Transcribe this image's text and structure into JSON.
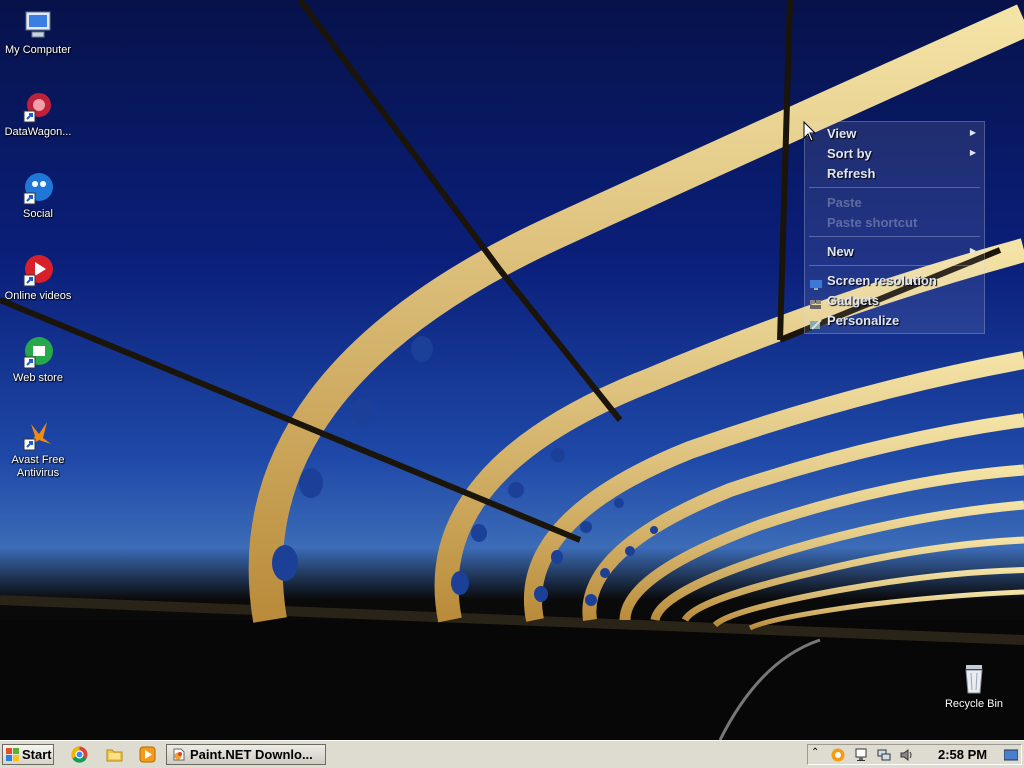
{
  "desktop": {
    "icons": [
      {
        "label": "My Computer",
        "icon": "computer-icon"
      },
      {
        "label": "DataWagon...",
        "icon": "datawagon-icon"
      },
      {
        "label": "Social",
        "icon": "social-icon"
      },
      {
        "label": "Online videos",
        "icon": "video-icon"
      },
      {
        "label": "Web store",
        "icon": "store-icon"
      },
      {
        "label": "Avast Free Antivirus",
        "icon": "avast-icon"
      },
      {
        "label": "Recycle Bin",
        "icon": "recycle-bin-icon"
      }
    ]
  },
  "context_menu": {
    "items": [
      {
        "label": "View",
        "enabled": true,
        "submenu": true
      },
      {
        "label": "Sort by",
        "enabled": true,
        "submenu": true
      },
      {
        "label": "Refresh",
        "enabled": true,
        "submenu": false
      },
      {
        "label": "Paste",
        "enabled": false,
        "submenu": false
      },
      {
        "label": "Paste shortcut",
        "enabled": false,
        "submenu": false
      },
      {
        "label": "New",
        "enabled": true,
        "submenu": true
      },
      {
        "label": "Screen resolution",
        "enabled": true,
        "submenu": false,
        "icon": "screen-resolution-icon"
      },
      {
        "label": "Gadgets",
        "enabled": true,
        "submenu": false,
        "icon": "gadgets-icon"
      },
      {
        "label": "Personalize",
        "enabled": true,
        "submenu": false,
        "icon": "personalize-icon"
      }
    ]
  },
  "taskbar": {
    "start_label": "Start",
    "quick_launch": [
      "chrome-icon",
      "explorer-icon",
      "media-player-icon"
    ],
    "tasks": [
      {
        "label": "Paint.NET Downlo...",
        "icon": "paint-net-icon"
      }
    ],
    "tray": {
      "icons": [
        "show-hidden-icons-chevron",
        "avast-tray-icon",
        "action-center-icon",
        "network-icon",
        "volume-icon"
      ],
      "clock": "2:58 PM"
    }
  },
  "colors": {
    "taskbar": "#dedbd1",
    "menu_text": "#dfe6f6",
    "arch_gold": "#e8c870"
  }
}
